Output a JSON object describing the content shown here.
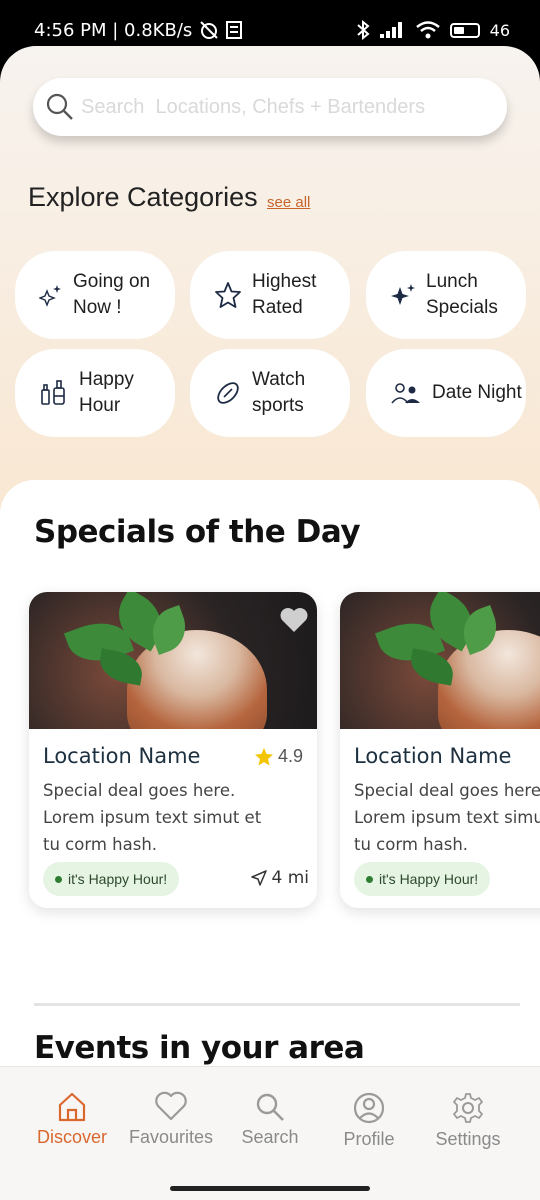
{
  "status_bar": {
    "time_speed": "4:56 PM | 0.8KB/s",
    "battery": "46"
  },
  "search": {
    "placeholder": "Search  Locations, Chefs + Bartenders"
  },
  "explore": {
    "title": "Explore Categories",
    "see_all": "see all"
  },
  "categories": [
    {
      "label": "Going on Now !",
      "icon": "sparkle-outline-icon"
    },
    {
      "label": "Highest Rated",
      "icon": "star-outline-icon"
    },
    {
      "label": "Lunch Specials",
      "icon": "sparkle-filled-icon"
    },
    {
      "label": "Happy Hour",
      "icon": "bottles-icon"
    },
    {
      "label": "Watch sports",
      "icon": "football-icon"
    },
    {
      "label": "Date Night",
      "icon": "couple-icon"
    }
  ],
  "specials": {
    "title": "Specials of the Day",
    "cards": [
      {
        "location": "Location Name",
        "rating": "4.9",
        "description": "Special deal goes here.\nLorem ipsum text simut et\ntu corm hash.",
        "badge": "it's Happy Hour!",
        "distance": "4 mi"
      },
      {
        "location": "Location Name",
        "rating": "",
        "description": "Special deal goes here.\nLorem ipsum text simut et\ntu corm hash.",
        "badge": "it's Happy Hour!",
        "distance": ""
      }
    ]
  },
  "events": {
    "title": "Events in your area"
  },
  "tabs": [
    {
      "label": "Discover",
      "icon": "home-icon",
      "active": true
    },
    {
      "label": "Favourites",
      "icon": "heart-icon",
      "active": false
    },
    {
      "label": "Search",
      "icon": "search-icon",
      "active": false
    },
    {
      "label": "Profile",
      "icon": "profile-icon",
      "active": false
    },
    {
      "label": "Settings",
      "icon": "gear-icon",
      "active": false
    }
  ],
  "colors": {
    "accent": "#d9682f",
    "badge_bg": "#e6f4e4",
    "star": "#f2c500"
  }
}
